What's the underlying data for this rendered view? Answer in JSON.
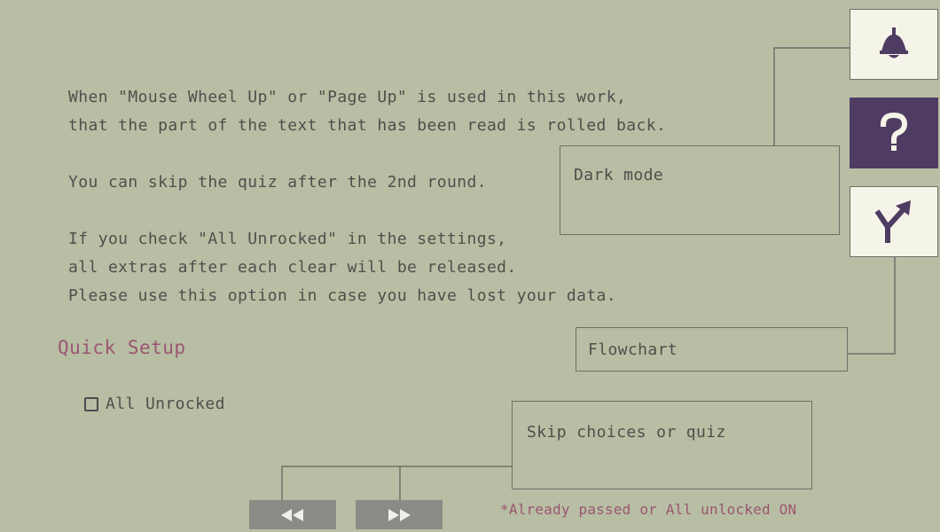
{
  "help": {
    "lines": [
      "When \"Mouse Wheel Up\" or \"Page Up\" is used in this work,",
      "that the part of the text that has been read is rolled back.",
      "You can skip the quiz after the 2nd round.",
      "If you check \"All Unrocked\" in the settings,",
      "all extras after each clear will be released.",
      "Please use this option in case you have lost your data."
    ]
  },
  "quick_setup": {
    "title": "Quick Setup",
    "checkbox_label": "All Unrocked",
    "checked": false
  },
  "callouts": {
    "dark_mode": "Dark mode",
    "flowchart": "Flowchart",
    "skip": "Skip choices or quiz"
  },
  "note": "*Already passed or All unlocked ON",
  "icons": {
    "lamp": "lamp-icon",
    "help": "question-mark-icon",
    "branch": "branch-arrow-icon",
    "rewind": "rewind-icon",
    "fast_forward": "fast-forward-icon"
  },
  "colors": {
    "background": "#b8bea3",
    "accent_text": "#9a5672",
    "button_light": "#f5f4e8",
    "button_dark": "#4f3c63",
    "nav_button": "#8b8b86",
    "icon_dark": "#4f3c63"
  }
}
